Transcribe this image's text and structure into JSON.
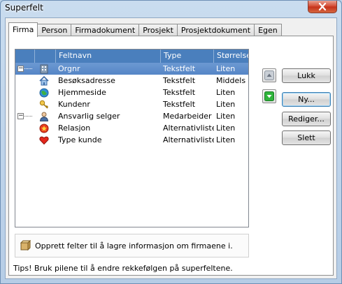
{
  "window": {
    "title": "Superfelt"
  },
  "tabs": [
    "Firma",
    "Person",
    "Firmadokument",
    "Prosjekt",
    "Prosjektdokument",
    "Egen"
  ],
  "list": {
    "columns": [
      "Feltnavn",
      "Type",
      "Størrelse"
    ],
    "rows": [
      {
        "name": "Orgnr",
        "type": "Tekstfelt",
        "size": "Liten",
        "icon": "building-icon",
        "selected": true,
        "expander": "-"
      },
      {
        "name": "Besøksadresse",
        "type": "Tekstfelt",
        "size": "Middels",
        "icon": "house-icon"
      },
      {
        "name": "Hjemmeside",
        "type": "Tekstfelt",
        "size": "Liten",
        "icon": "globe-icon"
      },
      {
        "name": "Kundenr",
        "type": "Tekstfelt",
        "size": "Liten",
        "icon": "key-icon"
      },
      {
        "name": "Ansvarlig selger",
        "type": "Medarbeider",
        "size": "Liten",
        "icon": "person-icon",
        "expander": "-"
      },
      {
        "name": "Relasjon",
        "type": "Alternativliste",
        "size": "Liten",
        "icon": "star-icon"
      },
      {
        "name": "Type kunde",
        "type": "Alternativliste",
        "size": "Liten",
        "icon": "heart-icon"
      }
    ]
  },
  "hint": {
    "text": "Opprett felter til å lagre informasjon om firmaene i.",
    "icon": "info-package-icon"
  },
  "tips": "Tips! Bruk pilene til å endre rekkefølgen på superfeltene.",
  "buttons": {
    "close": "Lukk",
    "new": "Ny...",
    "edit": "Rediger...",
    "delete": "Slett"
  },
  "colors": {
    "header": "#4a7fbd",
    "selected_row": "#5f8fcc",
    "arrow_down": "#2fb43b"
  }
}
